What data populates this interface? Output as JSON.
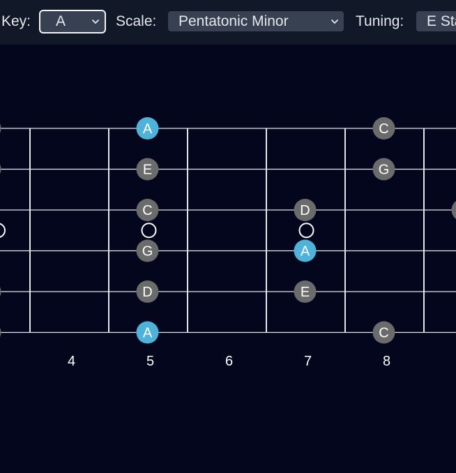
{
  "toolbar": {
    "key_label": "Key:",
    "key_value": "A",
    "scale_label": "Scale:",
    "scale_value": "Pentatonic Minor",
    "tuning_label": "Tuning:",
    "tuning_value": "E Standard"
  },
  "colors": {
    "background": "#03061c",
    "toolbar": "#111827",
    "select": "#374151",
    "string_line": "#e5e7eb",
    "root_note": "#4fb3d9",
    "scale_note": "#6b6b6b"
  },
  "fretboard": {
    "fret_numbers": [
      {
        "fret": 4,
        "label": "4"
      },
      {
        "fret": 5,
        "label": "5"
      },
      {
        "fret": 6,
        "label": "6"
      },
      {
        "fret": 7,
        "label": "7"
      },
      {
        "fret": 8,
        "label": "8"
      }
    ],
    "markers": [
      5,
      7
    ],
    "notes": [
      {
        "string": 1,
        "fret": 3,
        "label": "G",
        "root": false
      },
      {
        "string": 1,
        "fret": 5,
        "label": "A",
        "root": true
      },
      {
        "string": 1,
        "fret": 8,
        "label": "C",
        "root": false
      },
      {
        "string": 2,
        "fret": 3,
        "label": "D",
        "root": false
      },
      {
        "string": 2,
        "fret": 5,
        "label": "E",
        "root": false
      },
      {
        "string": 2,
        "fret": 8,
        "label": "G",
        "root": false
      },
      {
        "string": 3,
        "fret": 5,
        "label": "C",
        "root": false
      },
      {
        "string": 3,
        "fret": 7,
        "label": "D",
        "root": false
      },
      {
        "string": 3,
        "fret": 9,
        "label": "E",
        "root": false
      },
      {
        "string": 4,
        "fret": 5,
        "label": "G",
        "root": false
      },
      {
        "string": 4,
        "fret": 7,
        "label": "A",
        "root": true
      },
      {
        "string": 5,
        "fret": 3,
        "label": "C",
        "root": false
      },
      {
        "string": 5,
        "fret": 5,
        "label": "D",
        "root": false
      },
      {
        "string": 5,
        "fret": 7,
        "label": "E",
        "root": false
      },
      {
        "string": 6,
        "fret": 3,
        "label": "G",
        "root": false
      },
      {
        "string": 6,
        "fret": 5,
        "label": "A",
        "root": true
      },
      {
        "string": 6,
        "fret": 8,
        "label": "C",
        "root": false
      }
    ]
  }
}
